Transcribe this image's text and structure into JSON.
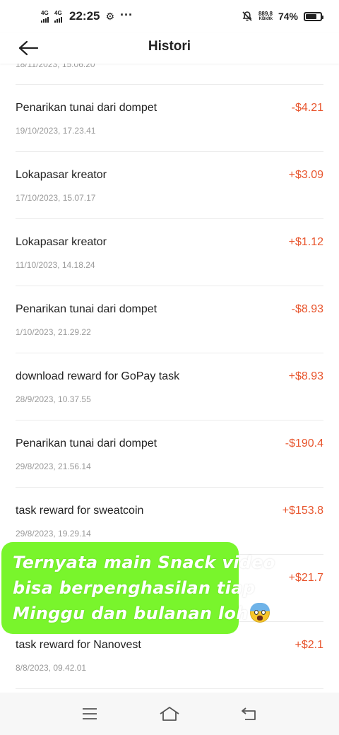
{
  "status_bar": {
    "network_1": "4G",
    "network_2": "4G",
    "time": "22:25",
    "speed_value": "889,8",
    "speed_unit": "KB/dtk",
    "battery_percent": "74%",
    "battery_level": 0.74
  },
  "header": {
    "title": "Histori"
  },
  "partial_item": {
    "date": "18/11/2023, 15.06.20"
  },
  "transactions": [
    {
      "title": "Penarikan tunai dari dompet",
      "date": "19/10/2023, 17.23.41",
      "amount": "-$4.21"
    },
    {
      "title": "Lokapasar kreator",
      "date": "17/10/2023, 15.07.17",
      "amount": "+$3.09"
    },
    {
      "title": "Lokapasar kreator",
      "date": "11/10/2023, 14.18.24",
      "amount": "+$1.12"
    },
    {
      "title": "Penarikan tunai dari dompet",
      "date": "1/10/2023, 21.29.22",
      "amount": "-$8.93"
    },
    {
      "title": "download reward for GoPay task",
      "date": "28/9/2023, 10.37.55",
      "amount": "+$8.93"
    },
    {
      "title": "Penarikan tunai dari dompet",
      "date": "29/8/2023, 21.56.14",
      "amount": "-$190.4"
    },
    {
      "title": "task reward for sweatcoin",
      "date": "29/8/2023, 19.29.14",
      "amount": "+$153.8"
    },
    {
      "title": "",
      "date": "",
      "amount": "+$21.7"
    },
    {
      "title": "task reward for Nanovest",
      "date": "8/8/2023, 09.42.01",
      "amount": "+$2.1"
    }
  ],
  "overlay": {
    "line1": "Ternyata main Snack video",
    "line2": "bisa berpenghasilan tiap",
    "line3": "Minggu dan bulanan loh"
  },
  "colors": {
    "amount": "#e8552d",
    "overlay_bg": "#79f52c",
    "date_text": "#9a9a9a"
  },
  "icons": {
    "back": "arrow-left-icon",
    "settings": "gear-icon",
    "more": "more-dots-icon",
    "silent": "bell-off-icon",
    "menu": "menu-icon",
    "home": "home-icon",
    "back_nav": "back-nav-icon"
  }
}
